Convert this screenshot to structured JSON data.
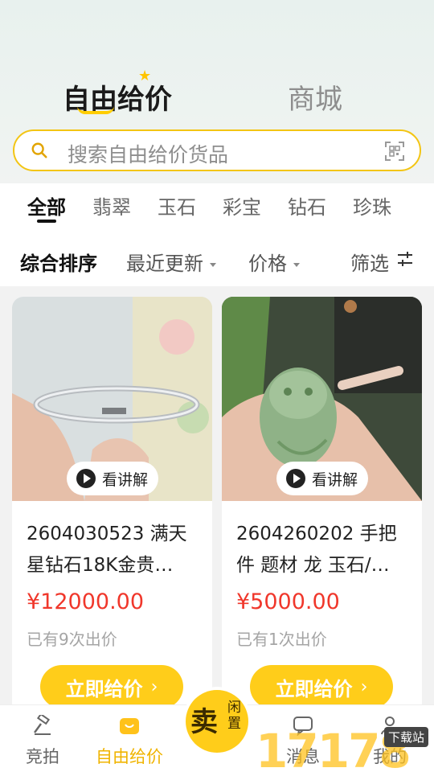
{
  "header": {
    "tabs": [
      {
        "label": "自由给价",
        "active": true
      },
      {
        "label": "商城",
        "active": false
      }
    ]
  },
  "search": {
    "placeholder": "搜索自由给价货品"
  },
  "categories": [
    "全部",
    "翡翠",
    "玉石",
    "彩宝",
    "钻石",
    "珍珠"
  ],
  "sort": {
    "items": [
      {
        "label": "综合排序",
        "active": true
      },
      {
        "label": "最近更新",
        "dropdown": true
      },
      {
        "label": "价格",
        "dropdown": true
      }
    ],
    "filter_label": "筛选"
  },
  "products": [
    {
      "title": "2604030523 满天星钻石18K金贵…",
      "price": "¥12000.00",
      "bids": "已有9次出价",
      "video_label": "看讲解",
      "button": "立即给价"
    },
    {
      "title": "2604260202 手把件 题材 龙 玉石/…",
      "price": "¥5000.00",
      "bids": "已有1次出价",
      "video_label": "看讲解",
      "button": "立即给价"
    }
  ],
  "bottom_nav": {
    "items": [
      {
        "label": "竞拍",
        "icon": "gavel-icon"
      },
      {
        "label": "自由给价",
        "icon": "bag-icon",
        "active": true
      },
      {
        "label": "消息",
        "icon": "message-icon"
      },
      {
        "label": "我的",
        "icon": "user-icon"
      }
    ],
    "sell": {
      "main": "卖",
      "sub": "闲置"
    }
  },
  "watermark": {
    "text": "17178",
    "tag": "下载站"
  },
  "colors": {
    "accent": "#ffcd1a",
    "price": "#f0372b",
    "border": "#f3c514"
  }
}
